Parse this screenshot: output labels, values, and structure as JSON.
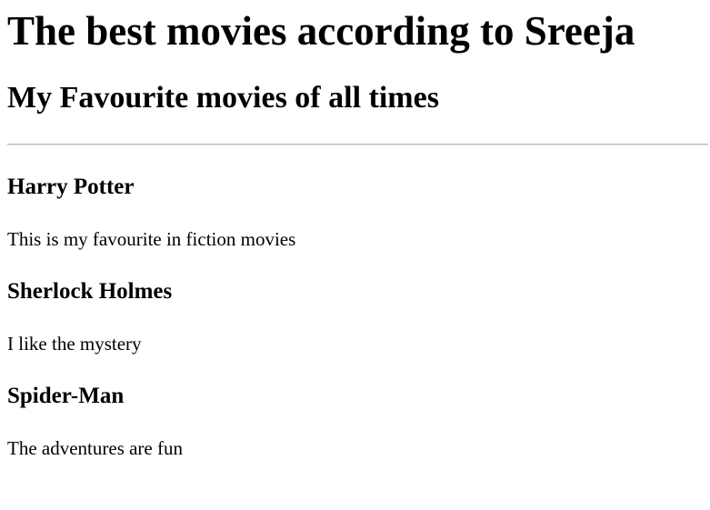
{
  "page": {
    "title": "The best movies according to Sreeja",
    "subtitle": "My Favourite movies of all times"
  },
  "movies": [
    {
      "title": "Harry Potter",
      "description": "This is my favourite in fiction movies"
    },
    {
      "title": "Sherlock Holmes",
      "description": "I like the mystery"
    },
    {
      "title": "Spider-Man",
      "description": "The adventures are fun"
    }
  ]
}
